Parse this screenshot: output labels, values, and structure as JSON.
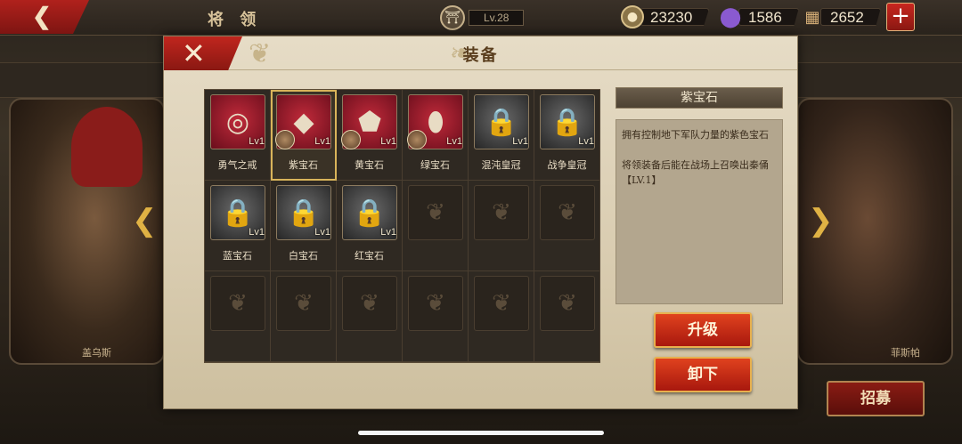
{
  "topbar": {
    "title": "将 领",
    "level": "Lv.28",
    "resources": [
      {
        "icon": "coin-icon",
        "value": "23230",
        "color": "#b99a5c"
      },
      {
        "icon": "purple-crystal-icon",
        "value": "1586",
        "color": "#6a3ea8"
      },
      {
        "icon": "scroll-icon",
        "value": "2652",
        "color": "#a07a4a"
      }
    ]
  },
  "heroes": {
    "left_name": "盖乌斯",
    "right_name": "菲斯帕"
  },
  "modal": {
    "title": "装备",
    "items": [
      {
        "name": "勇气之戒",
        "lv": "Lv1",
        "style": "red",
        "glyph": "◎",
        "owner": false
      },
      {
        "name": "紫宝石",
        "lv": "Lv1",
        "style": "red",
        "glyph": "◆",
        "owner": true,
        "selected": true
      },
      {
        "name": "黄宝石",
        "lv": "Lv1",
        "style": "red",
        "glyph": "⬟",
        "owner": true
      },
      {
        "name": "绿宝石",
        "lv": "Lv1",
        "style": "red",
        "glyph": "⬮",
        "owner": true
      },
      {
        "name": "混沌皇冠",
        "lv": "Lv1",
        "style": "gray",
        "glyph": "🔒",
        "owner": false
      },
      {
        "name": "战争皇冠",
        "lv": "Lv1",
        "style": "gray",
        "glyph": "🔒",
        "owner": false
      },
      {
        "name": "蓝宝石",
        "lv": "Lv1",
        "style": "gray",
        "glyph": "🔒",
        "owner": false
      },
      {
        "name": "白宝石",
        "lv": "Lv1",
        "style": "gray",
        "glyph": "🔒",
        "owner": false
      },
      {
        "name": "红宝石",
        "lv": "Lv1",
        "style": "gray",
        "glyph": "🔒",
        "owner": false
      }
    ],
    "empty_slots": 9,
    "detail": {
      "title": "紫宝石",
      "desc1": "拥有控制地下军队力量的紫色宝石",
      "desc2": "将领装备后能在战场上召唤出秦俑【LV.1】"
    },
    "upgrade_label": "升级",
    "unequip_label": "卸下"
  },
  "recruit_label": "招募"
}
